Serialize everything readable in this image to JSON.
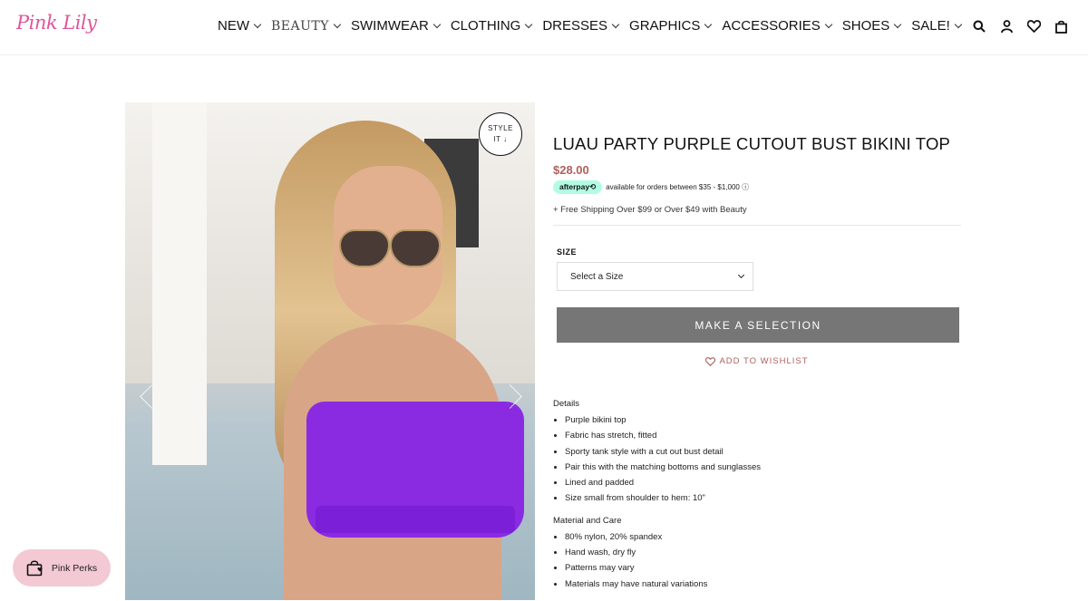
{
  "header": {
    "logo": "Pink Lily",
    "nav": [
      {
        "label": "NEW"
      },
      {
        "label": "BEAUTY"
      },
      {
        "label": "SWIMWEAR"
      },
      {
        "label": "CLOTHING"
      },
      {
        "label": "DRESSES"
      },
      {
        "label": "GRAPHICS"
      },
      {
        "label": "ACCESSORIES"
      },
      {
        "label": "SHOES"
      },
      {
        "label": "SALE!"
      }
    ],
    "icons": [
      "search-icon",
      "account-icon",
      "heart-icon",
      "bag-icon"
    ]
  },
  "image": {
    "style_it_line1": "STYLE",
    "style_it_line2": "IT ↓"
  },
  "product": {
    "title": "LUAU PARTY PURPLE CUTOUT BUST BIKINI TOP",
    "price": "$28.00",
    "afterpay_badge": "afterpay⟲",
    "afterpay_text": "available for orders between $35 - $1,000 ⓘ",
    "shipping": "+ Free Shipping Over $99 or Over $49 with Beauty",
    "size_label": "SIZE",
    "size_select": "Select a Size",
    "cta": "MAKE A SELECTION",
    "wishlist": "ADD TO WISHLIST",
    "details_title": "Details",
    "details": [
      "Purple bikini top",
      "Fabric has stretch, fitted",
      "Sporty tank style with a cut out bust detail",
      "Pair this with the matching bottoms and sunglasses",
      "Lined and padded",
      "Size small from shoulder to hem: 10\""
    ],
    "care_title": "Material and Care",
    "care": [
      "80% nylon, 20% spandex",
      "Hand wash, dry fly",
      "Patterns may vary",
      "Materials may have natural variations"
    ]
  },
  "perks": {
    "label": "Pink Perks"
  },
  "colors": {
    "brand_pink": "#e0559a",
    "price": "#b0605d",
    "button": "#767676",
    "perks_bg": "#f3c9d3",
    "afterpay": "#b2fce4"
  }
}
